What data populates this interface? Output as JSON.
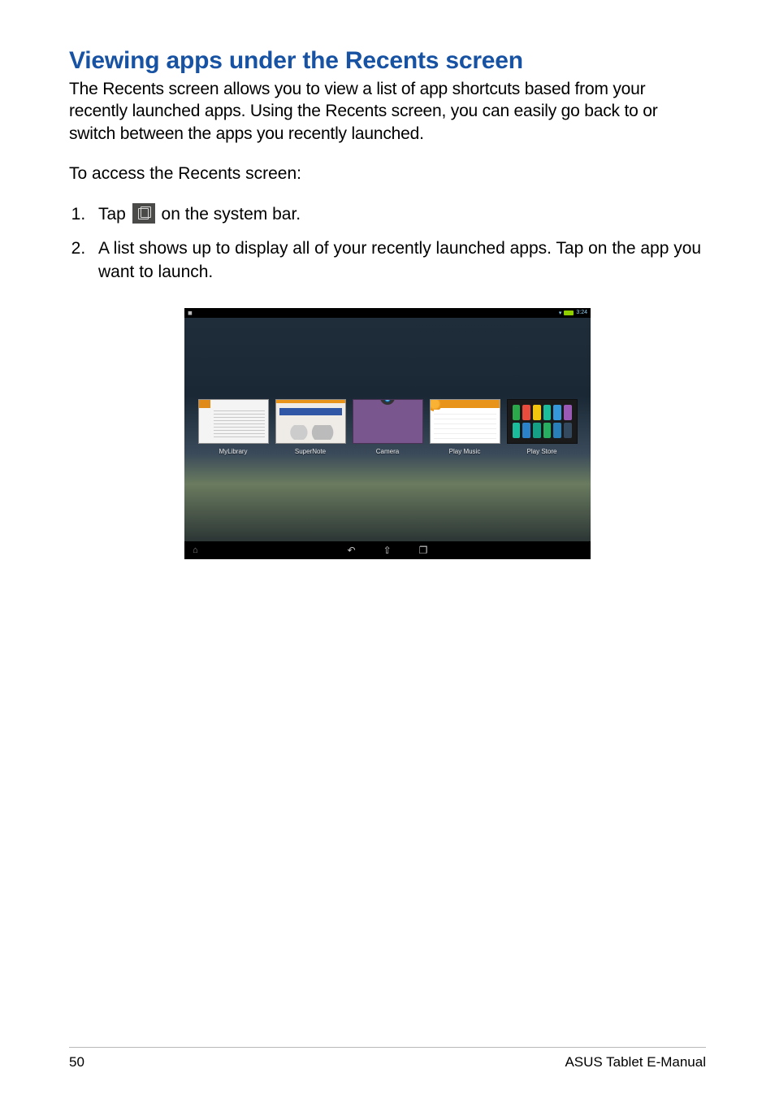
{
  "heading": "Viewing apps under the Recents screen",
  "intro": "The Recents screen allows you to view a list of app shortcuts based from your recently launched apps. Using the Recents screen, you can easily go back to or switch between the apps you recently launched.",
  "lead": "To access the Recents screen:",
  "steps": {
    "s1_pre": "Tap ",
    "s1_post": " on the system bar.",
    "s2": "A list shows up to display all of your recently launched apps. Tap on the app you want to launch."
  },
  "screenshot": {
    "status_time": "3:24",
    "apps": [
      {
        "label": "MyLibrary"
      },
      {
        "label": "SuperNote"
      },
      {
        "label": "Camera"
      },
      {
        "label": "Play Music"
      },
      {
        "label": "Play Store"
      }
    ],
    "store_icon_colors": [
      "#2aa84a",
      "#e74c3c",
      "#f1c40f",
      "#1abc9c",
      "#3498db",
      "#9b59b6",
      "#1abc9c",
      "#2c82c9",
      "#16a085",
      "#27ae60",
      "#2980b9",
      "#34495e"
    ]
  },
  "footer": {
    "page": "50",
    "doc": "ASUS Tablet E-Manual"
  }
}
